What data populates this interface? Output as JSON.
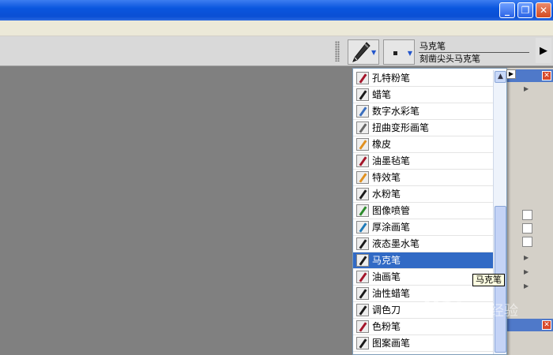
{
  "window": {
    "minimize_glyph": "_",
    "maximize_glyph": "❐",
    "close_glyph": "✕"
  },
  "property_bar": {
    "brush_category_icon": "pen-nib-icon",
    "brush_name": "马克笔",
    "brush_variant": "刻凿尖头马克笔"
  },
  "brush_list": {
    "items": [
      {
        "label": "孔特粉笔",
        "icon": "conte-crayon-icon",
        "color": "#a4152a"
      },
      {
        "label": "蜡笔",
        "icon": "crayon-icon",
        "color": "#1a1a1a"
      },
      {
        "label": "数字水彩笔",
        "icon": "digital-watercolor-icon",
        "color": "#3a6ebd"
      },
      {
        "label": "扭曲变形画笔",
        "icon": "distortion-icon",
        "color": "#666666"
      },
      {
        "label": "橡皮",
        "icon": "eraser-icon",
        "color": "#e09020"
      },
      {
        "label": "油墨毡笔",
        "icon": "felt-pen-icon",
        "color": "#a4152a"
      },
      {
        "label": "特效笔",
        "icon": "fx-icon",
        "color": "#e09020"
      },
      {
        "label": "水粉笔",
        "icon": "gouache-icon",
        "color": "#1a1a1a"
      },
      {
        "label": "图像喷管",
        "icon": "image-hose-icon",
        "color": "#2b8a2b"
      },
      {
        "label": "厚涂画笔",
        "icon": "impasto-icon",
        "color": "#1e7ab8"
      },
      {
        "label": "液态墨水笔",
        "icon": "liquid-ink-icon",
        "color": "#1a1a1a"
      },
      {
        "label": "马克笔",
        "icon": "marker-icon",
        "color": "#1a1a1a",
        "selected": true
      },
      {
        "label": "油画笔",
        "icon": "oil-brush-icon",
        "color": "#a4152a"
      },
      {
        "label": "油性蜡笔",
        "icon": "oil-pastel-icon",
        "color": "#1a1a1a"
      },
      {
        "label": "调色刀",
        "icon": "palette-knife-icon",
        "color": "#1a1a1a"
      },
      {
        "label": "色粉笔",
        "icon": "pastel-icon",
        "color": "#a4152a"
      },
      {
        "label": "图案画笔",
        "icon": "pattern-pen-icon",
        "color": "#1a1a1a"
      }
    ]
  },
  "tooltip": "马克笔",
  "watermark": "Bai 经验"
}
